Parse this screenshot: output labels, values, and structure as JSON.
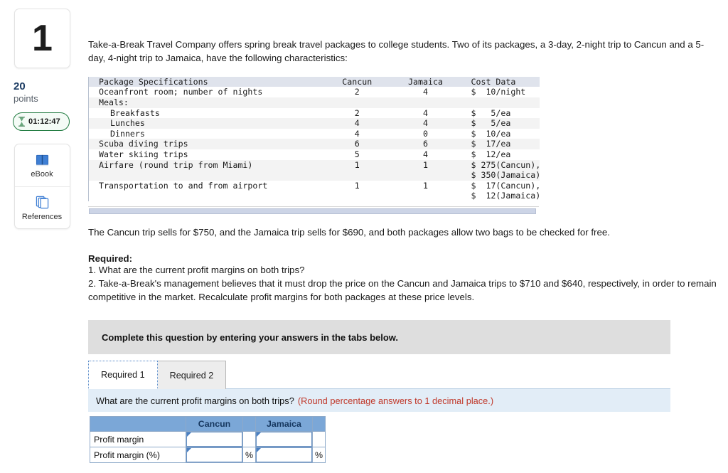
{
  "sidebar": {
    "question_number": "1",
    "points_value": "20",
    "points_label": "points",
    "timer": "01:12:47",
    "timer_icon": "hourglass-icon",
    "tools": [
      {
        "label": "eBook",
        "icon": "book-icon"
      },
      {
        "label": "References",
        "icon": "pages-stack-icon"
      }
    ]
  },
  "main": {
    "intro": "Take-a-Break Travel Company offers spring break travel packages to college students. Two of its packages, a 3-day, 2-night trip to Cancun and a 5-day, 4-night trip to Jamaica, have the following characteristics:",
    "sells_text": "The Cancun trip sells for $750, and the Jamaica trip sells for $690, and both packages allow two bags to be checked for free.",
    "required_heading": "Required:",
    "required_1": "1. What are the current profit margins on both trips?",
    "required_2": "2. Take-a-Break's management believes that it must drop the price on the Cancun and Jamaica trips to $710 and $640, respectively, in order to remain competitive in the market. Recalculate profit margins for both packages at these price levels.",
    "banner_text": "Complete this question by entering your answers in the tabs below."
  },
  "spec_table": {
    "headers": [
      "Package Specifications",
      "Cancun",
      "Jamaica",
      "Cost Data"
    ],
    "rows": [
      {
        "style": "plain",
        "name": "Oceanfront room; number of nights",
        "indent": 0,
        "cancun": "2",
        "jamaica": "4",
        "cost": "$  10/night"
      },
      {
        "style": "alt",
        "name": "Meals:",
        "indent": 0,
        "cancun": "",
        "jamaica": "",
        "cost": ""
      },
      {
        "style": "plain",
        "name": "Breakfasts",
        "indent": 1,
        "cancun": "2",
        "jamaica": "4",
        "cost": "$   5/ea"
      },
      {
        "style": "alt",
        "name": "Lunches",
        "indent": 1,
        "cancun": "4",
        "jamaica": "4",
        "cost": "$   5/ea"
      },
      {
        "style": "plain",
        "name": "Dinners",
        "indent": 1,
        "cancun": "4",
        "jamaica": "0",
        "cost": "$  10/ea"
      },
      {
        "style": "alt",
        "name": "Scuba diving trips",
        "indent": 0,
        "cancun": "6",
        "jamaica": "6",
        "cost": "$  17/ea"
      },
      {
        "style": "plain",
        "name": "Water skiing trips",
        "indent": 0,
        "cancun": "5",
        "jamaica": "4",
        "cost": "$  12/ea"
      },
      {
        "style": "alt",
        "name": "Airfare (round trip from Miami)",
        "indent": 0,
        "cancun": "1",
        "jamaica": "1",
        "cost": "$ 275(Cancun),"
      },
      {
        "style": "alt",
        "name": "",
        "indent": 0,
        "cancun": "",
        "jamaica": "",
        "cost": "$ 350(Jamaica)"
      },
      {
        "style": "plain",
        "name": "Transportation to and from airport",
        "indent": 0,
        "cancun": "1",
        "jamaica": "1",
        "cost": "$  17(Cancun),"
      },
      {
        "style": "plain",
        "name": "",
        "indent": 0,
        "cancun": "",
        "jamaica": "",
        "cost": "$  12(Jamaica)"
      }
    ]
  },
  "tabs": [
    {
      "label": "Required 1",
      "active": true
    },
    {
      "label": "Required 2",
      "active": false
    }
  ],
  "question_bar": {
    "question": "What are the current profit margins on both trips?",
    "hint": "(Round percentage answers to 1 decimal place.)"
  },
  "answer_table": {
    "headers": [
      "",
      "Cancun",
      "Jamaica"
    ],
    "rows": [
      {
        "label": "Profit margin",
        "cancun_value": "",
        "jamaica_value": "",
        "suffix": ""
      },
      {
        "label": "Profit margin (%)",
        "cancun_value": "",
        "jamaica_value": "",
        "suffix": "%"
      }
    ]
  },
  "colors": {
    "header_blue": "#7ba7d7",
    "question_bar_blue": "#e2edf7",
    "banner_gray": "#dedede",
    "hint_red": "#c0392b",
    "points_navy": "#1c3c63",
    "timer_green": "#1f7a3f"
  }
}
